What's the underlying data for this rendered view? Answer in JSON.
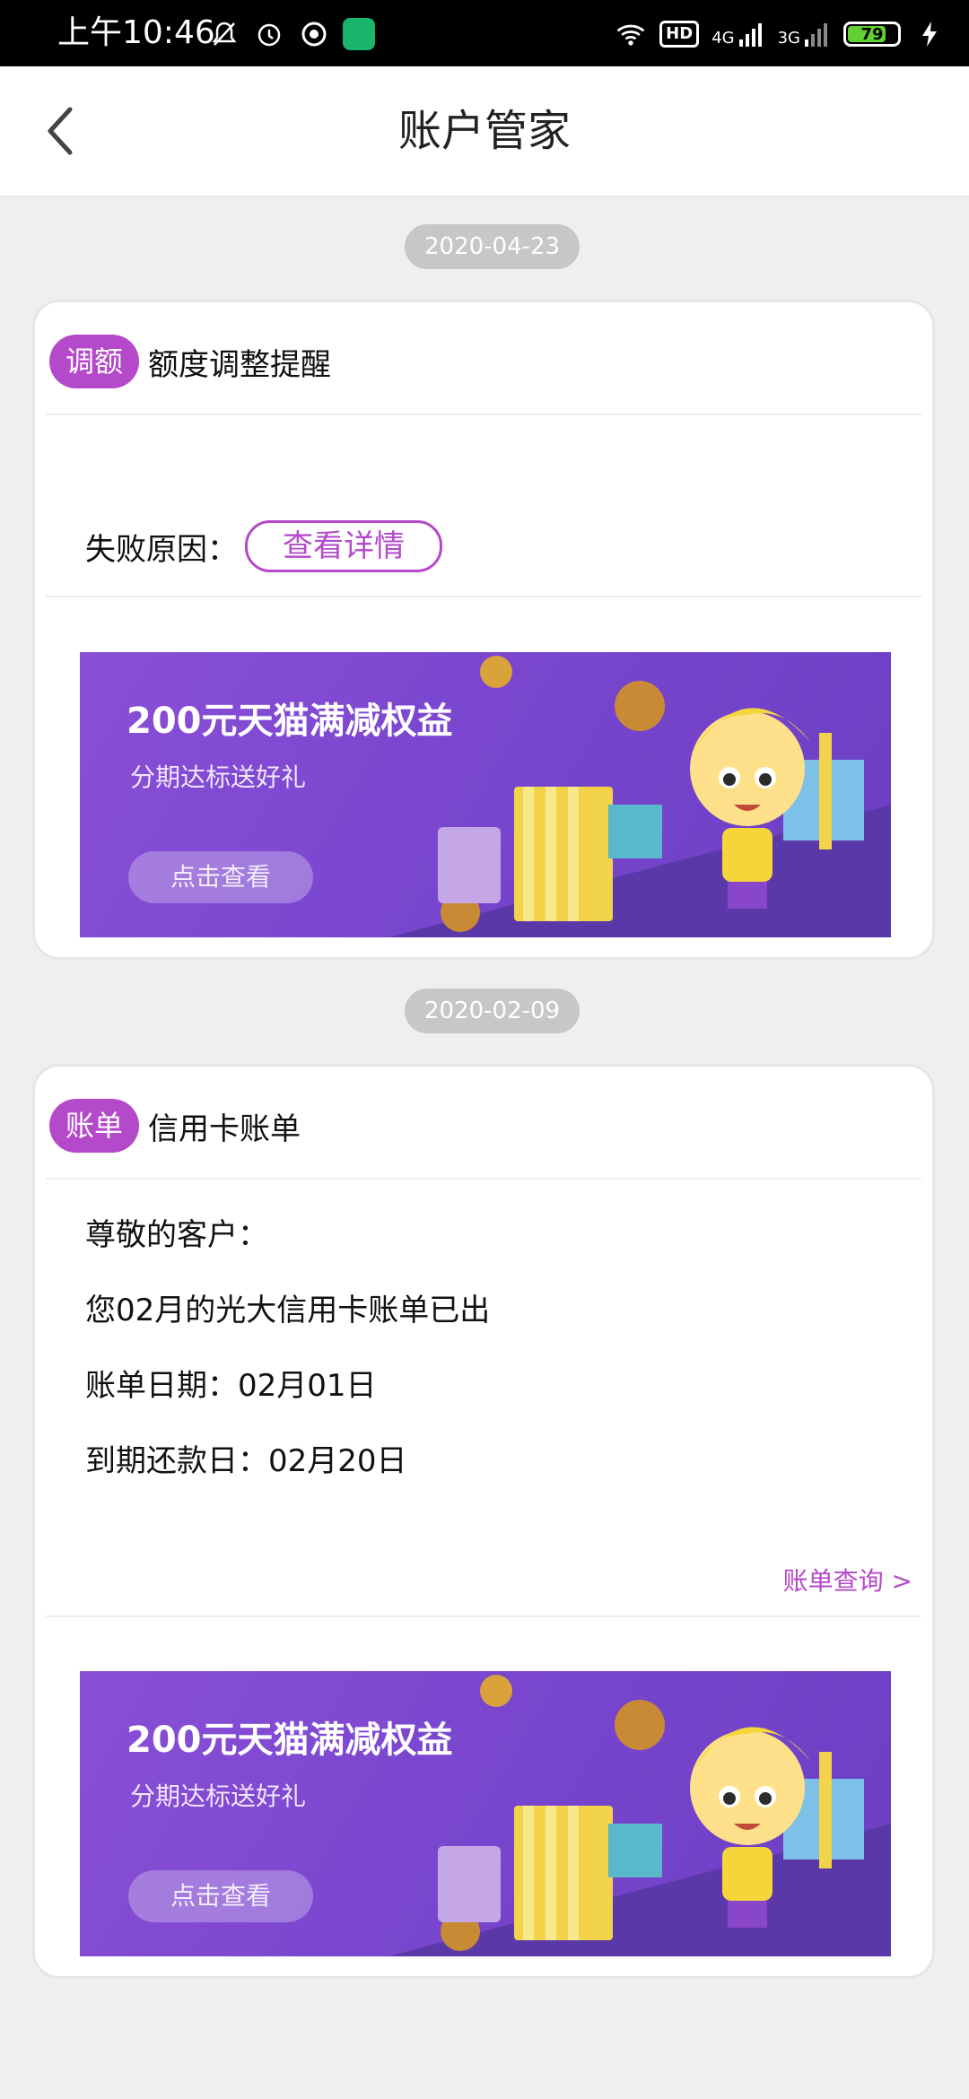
{
  "status_bar": {
    "time": "上午10:46",
    "left_icons": [
      "mute-bell-icon",
      "alarm-icon",
      "vpn-icon",
      "app-notification-icon"
    ],
    "right_icons": [
      "wifi-icon",
      "hd-icon",
      "signal-4g-icon",
      "signal-3g-icon",
      "battery-icon",
      "charging-icon"
    ],
    "hd_label": "HD",
    "net1": "4G",
    "net2": "3G",
    "battery_percent": 79,
    "battery_text": "79"
  },
  "header": {
    "title": "账户管家",
    "back_icon": "chevron-left-icon"
  },
  "messages": [
    {
      "date": "2020-04-23",
      "tag": "调额",
      "title": "额度调整提醒",
      "fail_reason_label": "失败原因：",
      "detail_button": "查看详情",
      "banner": {
        "title": "200元天猫满减权益",
        "subtitle": "分期达标送好礼",
        "button": "点击查看"
      }
    },
    {
      "date": "2020-02-09",
      "tag": "账单",
      "title": "信用卡账单",
      "lines": [
        "尊敬的客户：",
        "您02月的光大信用卡账单已出",
        "账单日期：02月01日",
        "到期还款日：02月20日"
      ],
      "bill_link": "账单查询 >",
      "banner": {
        "title": "200元天猫满减权益",
        "subtitle": "分期达标送好礼",
        "button": "点击查看"
      }
    }
  ],
  "colors": {
    "accent": "#b449c9",
    "banner_purple": "#7a46cf",
    "page_bg": "#efefef",
    "date_pill": "#c7c7c7"
  }
}
